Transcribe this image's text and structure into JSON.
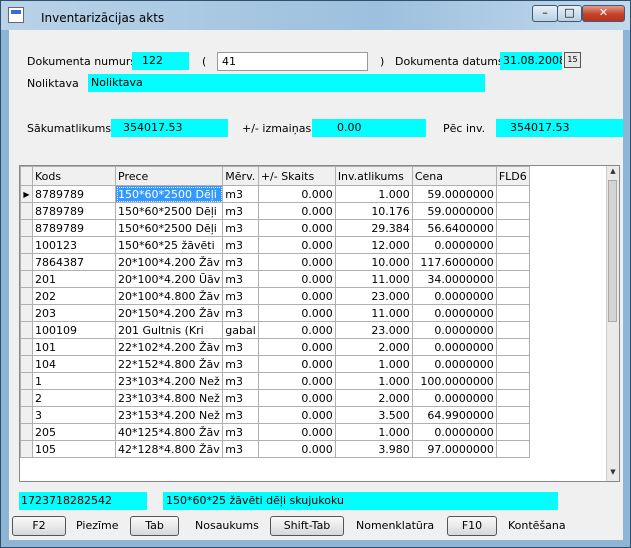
{
  "window": {
    "title": "Inventarizācijas akts",
    "min": "–",
    "max": "□",
    "close": "✕"
  },
  "form": {
    "doc_num_label": "Dokumenta numurs",
    "doc_num": "122",
    "paren_open": "(",
    "doc_ref": "41",
    "paren_close": ")",
    "doc_date_label": "Dokumenta datums",
    "doc_date": "31.08.2008",
    "calendar_glyph": "15",
    "warehouse_label": "Noliktava",
    "warehouse": "Noliktava",
    "start_balance_label": "Sākumatlikums",
    "start_balance": "354017.53",
    "change_label": "+/- izmaiņas",
    "change": "0.00",
    "after_label": "Pēc inv.",
    "after": "354017.53"
  },
  "grid": {
    "columns": [
      "Kods",
      "Prece",
      "Mērv.",
      "+/- Skaits",
      "Inv.atlikums",
      "Cena",
      "FLD6"
    ],
    "rows": [
      [
        "8789789",
        "150*60*2500 Dēļi",
        "m3",
        "0.000",
        "1.000",
        "59.0000000",
        ""
      ],
      [
        "8789789",
        "150*60*2500 Dēļi",
        "m3",
        "0.000",
        "10.176",
        "59.0000000",
        ""
      ],
      [
        "8789789",
        "150*60*2500 Dēļi",
        "m3",
        "0.000",
        "29.384",
        "56.6400000",
        ""
      ],
      [
        "100123",
        "150*60*25 žāvēti",
        "m3",
        "0.000",
        "12.000",
        "0.0000000",
        ""
      ],
      [
        "7864387",
        "20*100*4.200 Žāv",
        "m3",
        "0.000",
        "10.000",
        "117.6000000",
        ""
      ],
      [
        "201",
        "20*100*4.200 Ūāv",
        "m3",
        "0.000",
        "11.000",
        "34.0000000",
        ""
      ],
      [
        "202",
        "20*100*4.800 Žāv",
        "m3",
        "0.000",
        "23.000",
        "0.0000000",
        ""
      ],
      [
        "203",
        "20*150*4.200 Žāv",
        "m3",
        "0.000",
        "11.000",
        "0.0000000",
        ""
      ],
      [
        "100109",
        "201 Gultnis (Kri",
        "gabal",
        "0.000",
        "23.000",
        "0.0000000",
        ""
      ],
      [
        "101",
        "22*102*4.200 Žāv",
        "m3",
        "0.000",
        "2.000",
        "0.0000000",
        ""
      ],
      [
        "104",
        "22*152*4.800 Žāv",
        "m3",
        "0.000",
        "1.000",
        "0.0000000",
        ""
      ],
      [
        "1",
        "23*103*4.200 Než",
        "m3",
        "0.000",
        "1.000",
        "100.0000000",
        ""
      ],
      [
        "2",
        "23*103*4.800 Než",
        "m3",
        "0.000",
        "2.000",
        "0.0000000",
        ""
      ],
      [
        "3",
        "23*153*4.200 Než",
        "m3",
        "0.000",
        "3.500",
        "64.9900000",
        ""
      ],
      [
        "205",
        "40*125*4.800 Žāv",
        "m3",
        "0.000",
        "1.000",
        "0.0000000",
        ""
      ],
      [
        "105",
        "42*128*4.800 Žāv",
        "m3",
        "0.000",
        "3.980",
        "97.0000000",
        ""
      ]
    ],
    "current_row": 0
  },
  "status": {
    "code": "1723718282542",
    "name": "150*60*25 žāvēti dēļi skujukoku"
  },
  "shortcuts": [
    {
      "key": "F2",
      "label": "Piezīme"
    },
    {
      "key": "Tab",
      "label": "Nosaukums"
    },
    {
      "key": "Shift-Tab",
      "label": "Nomenklatūra"
    },
    {
      "key": "F10",
      "label": "Kontēšana"
    }
  ],
  "colors": {
    "field_bg": "#00ffff",
    "selection": "#3399ff"
  }
}
